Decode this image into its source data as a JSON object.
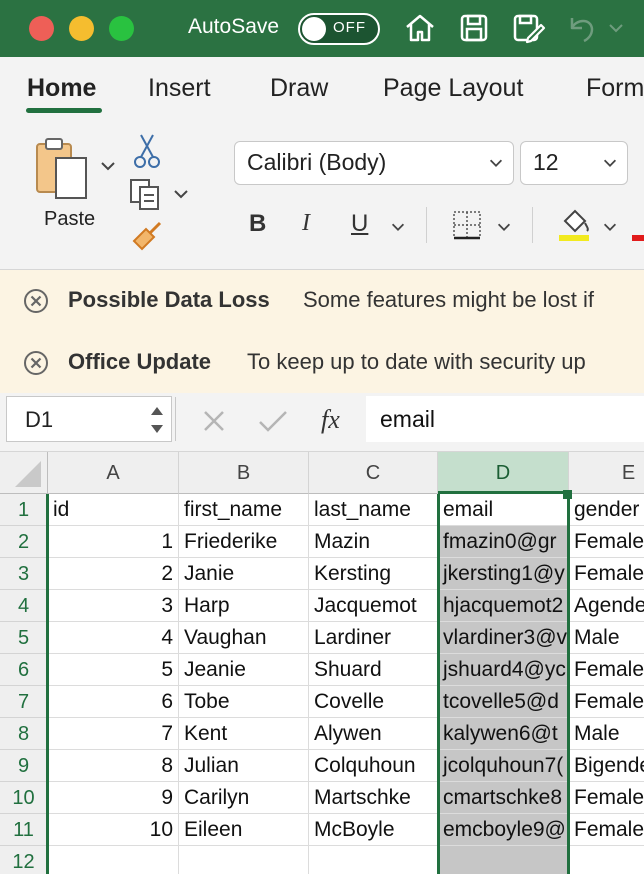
{
  "titlebar": {
    "autosave_label": "AutoSave",
    "autosave_state": "OFF",
    "icons": [
      "home-icon",
      "save-icon",
      "save-edit-icon",
      "undo-icon",
      "chevron-down-icon"
    ]
  },
  "ribbon": {
    "tabs": [
      "Home",
      "Insert",
      "Draw",
      "Page Layout",
      "Form"
    ],
    "active_tab": "Home",
    "paste_label": "Paste",
    "font_name": "Calibri (Body)",
    "font_size": "12",
    "bold": "B",
    "italic": "I",
    "underline": "U"
  },
  "messages": [
    {
      "title": "Possible Data Loss",
      "text": "Some features might be lost if"
    },
    {
      "title": "Office Update",
      "text": "To keep up to date with security up"
    }
  ],
  "formula_bar": {
    "name_box": "D1",
    "fx": "fx",
    "content": "email"
  },
  "sheet": {
    "columns": [
      "A",
      "B",
      "C",
      "D",
      "E"
    ],
    "rows": [
      "1",
      "2",
      "3",
      "4",
      "5",
      "6",
      "7",
      "8",
      "9",
      "10",
      "11",
      "12"
    ],
    "header": [
      "id",
      "first_name",
      "last_name",
      "email",
      "gender"
    ],
    "data": [
      [
        "1",
        "Friederike",
        "Mazin",
        "fmazin0@gr",
        "Female"
      ],
      [
        "2",
        "Janie",
        "Kersting",
        "jkersting1@y",
        "Female"
      ],
      [
        "3",
        "Harp",
        "Jacquemot",
        "hjacquemot2",
        "Agende"
      ],
      [
        "4",
        "Vaughan",
        "Lardiner",
        "vlardiner3@v",
        "Male"
      ],
      [
        "5",
        "Jeanie",
        "Shuard",
        "jshuard4@yc",
        "Female"
      ],
      [
        "6",
        "Tobe",
        "Covelle",
        "tcovelle5@d",
        "Female"
      ],
      [
        "7",
        "Kent",
        "Alywen",
        "kalywen6@t",
        "Male"
      ],
      [
        "8",
        "Julian",
        "Colquhoun",
        "jcolquhoun7(",
        "Bigende"
      ],
      [
        "9",
        "Carilyn",
        "Martschke",
        "cmartschke8",
        "Female"
      ],
      [
        "10",
        "Eileen",
        "McBoyle",
        "emcboyle9@",
        "Female"
      ]
    ],
    "selected_cell": "D1"
  },
  "colors": {
    "accent": "#21703f",
    "titlebar": "#2b7242",
    "selection_fill": "#c6c6c6"
  }
}
